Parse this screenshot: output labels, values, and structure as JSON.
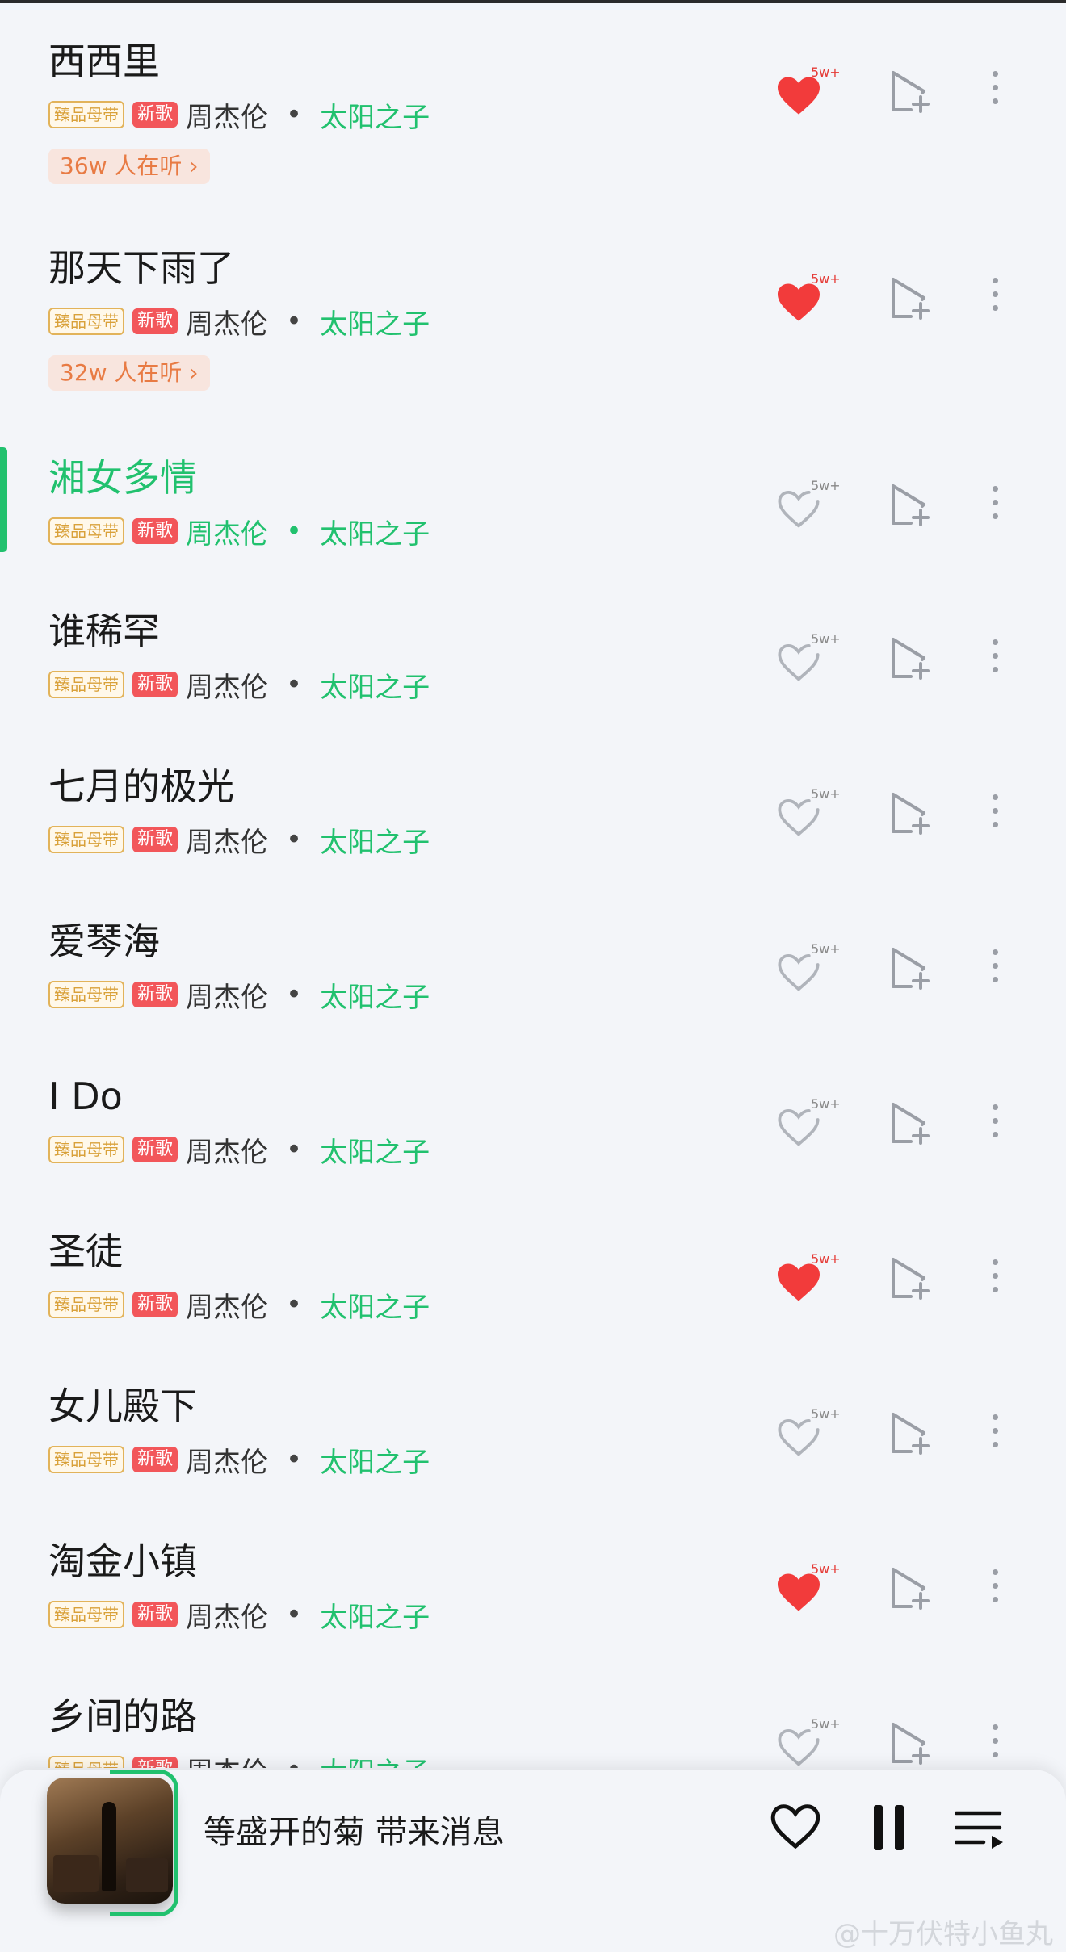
{
  "songs": [
    {
      "title": "西西里",
      "quality": "臻品母带",
      "new": "新歌",
      "artist": "周杰伦",
      "dot": "•",
      "album": "太阳之子",
      "listeners": "36w 人在听 ›",
      "like_count": "5w+",
      "liked": true
    },
    {
      "title": "那天下雨了",
      "quality": "臻品母带",
      "new": "新歌",
      "artist": "周杰伦",
      "dot": "•",
      "album": "太阳之子",
      "listeners": "32w 人在听 ›",
      "like_count": "5w+",
      "liked": true
    },
    {
      "title": "湘女多情",
      "quality": "臻品母带",
      "new": "新歌",
      "artist": "周杰伦",
      "dot": "•",
      "album": "太阳之子",
      "like_count": "5w+",
      "liked": false,
      "active": true
    },
    {
      "title": "谁稀罕",
      "quality": "臻品母带",
      "new": "新歌",
      "artist": "周杰伦",
      "dot": "•",
      "album": "太阳之子",
      "like_count": "5w+",
      "liked": false
    },
    {
      "title": "七月的极光",
      "quality": "臻品母带",
      "new": "新歌",
      "artist": "周杰伦",
      "dot": "•",
      "album": "太阳之子",
      "like_count": "5w+",
      "liked": false
    },
    {
      "title": "爱琴海",
      "quality": "臻品母带",
      "new": "新歌",
      "artist": "周杰伦",
      "dot": "•",
      "album": "太阳之子",
      "like_count": "5w+",
      "liked": false
    },
    {
      "title": "I Do",
      "quality": "臻品母带",
      "new": "新歌",
      "artist": "周杰伦",
      "dot": "•",
      "album": "太阳之子",
      "like_count": "5w+",
      "liked": false
    },
    {
      "title": "圣徒",
      "quality": "臻品母带",
      "new": "新歌",
      "artist": "周杰伦",
      "dot": "•",
      "album": "太阳之子",
      "like_count": "5w+",
      "liked": true
    },
    {
      "title": "女儿殿下",
      "quality": "臻品母带",
      "new": "新歌",
      "artist": "周杰伦",
      "dot": "•",
      "album": "太阳之子",
      "like_count": "5w+",
      "liked": false
    },
    {
      "title": "淘金小镇",
      "quality": "臻品母带",
      "new": "新歌",
      "artist": "周杰伦",
      "dot": "•",
      "album": "太阳之子",
      "like_count": "5w+",
      "liked": true
    },
    {
      "title": "乡间的路",
      "quality": "臻品母带",
      "new": "新歌",
      "artist": "周杰伦",
      "dot": "•",
      "album": "太阳之子",
      "like_count": "5w+",
      "liked": false
    }
  ],
  "player": {
    "now_playing": "等盛开的菊 带来消息",
    "like_icon": "heart-outline-icon",
    "pause_icon": "pause-icon",
    "queue_icon": "playlist-queue-icon"
  },
  "watermark": "@十万伏特小鱼丸",
  "colors": {
    "accent": "#21c16e",
    "like_red": "#f23b3b",
    "badge_new": "#f2565a",
    "badge_quality": "#e2b35a"
  }
}
